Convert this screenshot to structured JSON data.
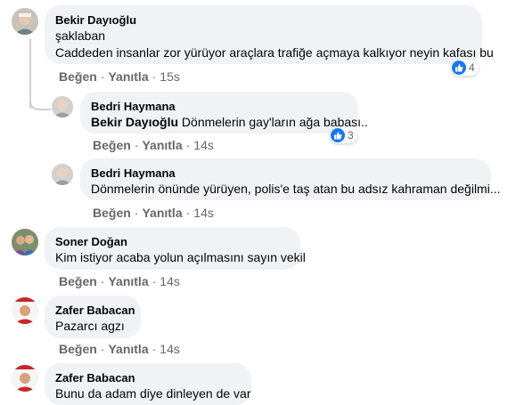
{
  "actions": {
    "like_label": "Beğen",
    "reply_label": "Yanıtla",
    "separator": "·"
  },
  "colors": {
    "bubble": "#f0f2f5",
    "meta": "#65676b",
    "like_blue": "#1877f2"
  },
  "comments": [
    {
      "author": "Bekir Dayıoğlu",
      "lines": [
        "şaklaban",
        "Caddeden insanlar zor yürüyor araçlara trafiğe açmaya kalkıyor neyin kafası bu"
      ],
      "time": "15s",
      "reaction": {
        "icon": "thumbs-up-icon",
        "count": "4"
      }
    },
    {
      "author": "Bedri Haymana",
      "mention": "Bekir Dayıoğlu",
      "text": "Dönmelerin gay'ların ağa babası..",
      "time": "14s",
      "reaction": {
        "icon": "thumbs-up-icon",
        "count": "3"
      }
    },
    {
      "author": "Bedri Haymana",
      "text": "Dönmelerin önünde yürüyen, polis'e taş atan bu adsız kahraman değilmi...",
      "time": "14s"
    },
    {
      "author": "Soner Doğan",
      "text": "Kim istiyor acaba yolun açılmasını sayın vekil",
      "time": "14s"
    },
    {
      "author": "Zafer Babacan",
      "text": "Pazarcı agzı",
      "time": "14s"
    },
    {
      "author": "Zafer Babacan",
      "text": "Bunu da adam diye dinleyen de var"
    }
  ]
}
